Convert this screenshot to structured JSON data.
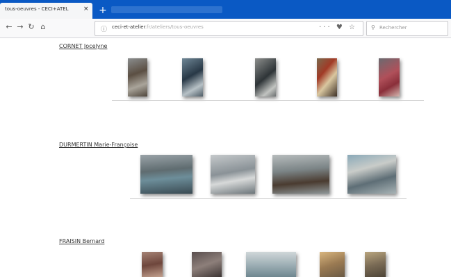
{
  "browser": {
    "tab_title": "tous-oeuvres - CECI+ATEL",
    "tab_close": "×",
    "new_tab": "+",
    "url": "ceci-et-atelier",
    "url_path": ".fr/ateliers/tous-oeuvres",
    "url_actions": "··· ♥ ☆",
    "search_placeholder": "Rechercher",
    "search_icon": "search-icon",
    "back_icon": "back-icon",
    "forward_icon": "forward-icon",
    "reload_icon": "reload-icon",
    "home_icon": "home-icon"
  },
  "artists": [
    {
      "name": "CORNET Jocelyne"
    },
    {
      "name": "DURMERTIN Marie-Françoise"
    },
    {
      "name": "FRAISIN Bernard"
    }
  ]
}
